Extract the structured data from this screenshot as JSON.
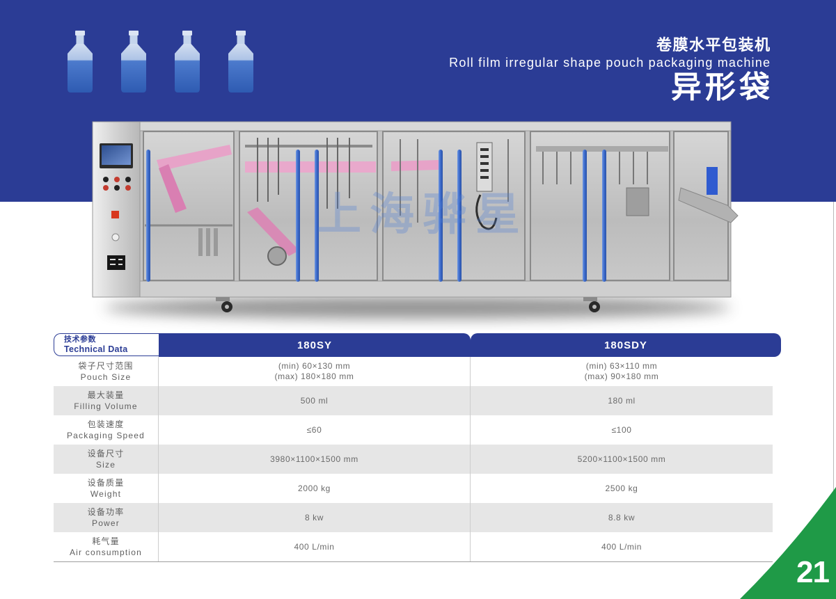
{
  "colors": {
    "brand_blue": "#2b3c95",
    "accent_green": "#1f9a47",
    "row_shade": "#e6e6e6",
    "guide_rod_blue": "#3b69c9",
    "pouch_liquid": "#3f6fc6"
  },
  "header": {
    "title_cn": "卷膜水平包装机",
    "title_en": "Roll film irregular shape pouch packaging machine",
    "subtitle_cn": "异形袋",
    "icons": [
      "pouch-icon",
      "pouch-icon",
      "pouch-icon",
      "pouch-icon"
    ]
  },
  "machine_photo": {
    "watermark": "上海骅星"
  },
  "specs": {
    "label_cn": "技术参数",
    "label_en": "Technical Data",
    "models": [
      "180SY",
      "180SDY"
    ],
    "rows": [
      {
        "label_cn": "袋子尺寸范围",
        "label_en": "Pouch Size",
        "values": [
          [
            "(min) 60×130 mm",
            "(max) 180×180 mm"
          ],
          [
            "(min) 63×110 mm",
            "(max) 90×180 mm"
          ]
        ]
      },
      {
        "label_cn": "最大装量",
        "label_en": "Filling Volume",
        "values": [
          [
            "500 ml"
          ],
          [
            "180 ml"
          ]
        ]
      },
      {
        "label_cn": "包装速度",
        "label_en": "Packaging Speed",
        "values": [
          [
            "≤60"
          ],
          [
            "≤100"
          ]
        ]
      },
      {
        "label_cn": "设备尺寸",
        "label_en": "Size",
        "values": [
          [
            "3980×1100×1500 mm"
          ],
          [
            "5200×1100×1500 mm"
          ]
        ]
      },
      {
        "label_cn": "设备质量",
        "label_en": "Weight",
        "values": [
          [
            "2000 kg"
          ],
          [
            "2500 kg"
          ]
        ]
      },
      {
        "label_cn": "设备功率",
        "label_en": "Power",
        "values": [
          [
            "8 kw"
          ],
          [
            "8.8 kw"
          ]
        ]
      },
      {
        "label_cn": "耗气量",
        "label_en": "Air consumption",
        "values": [
          [
            "400 L/min"
          ],
          [
            "400 L/min"
          ]
        ]
      }
    ]
  },
  "footer": {
    "page_number": "21"
  }
}
